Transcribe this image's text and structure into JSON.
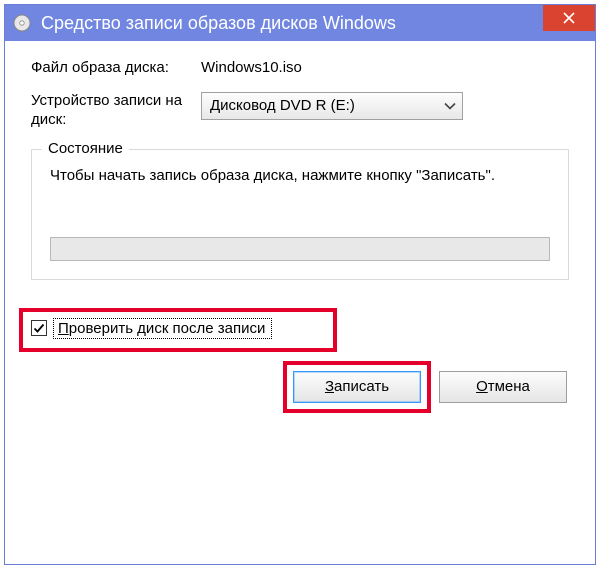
{
  "window": {
    "title": "Средство записи образов дисков Windows"
  },
  "fields": {
    "imageFileLabel": "Файл образа диска:",
    "imageFileValue": "Windows10.iso",
    "burnerLabel": "Устройство записи на диск:",
    "burnerValue": "Дисковод DVD R (E:)"
  },
  "status": {
    "legend": "Состояние",
    "text": "Чтобы начать запись образа диска, нажмите кнопку \"Записать\"."
  },
  "verify": {
    "firstLetter": "П",
    "rest": "роверить диск после записи"
  },
  "buttons": {
    "burnFirst": "З",
    "burnRest": "аписать",
    "cancelFirst": "О",
    "cancelRest": "тмена"
  }
}
